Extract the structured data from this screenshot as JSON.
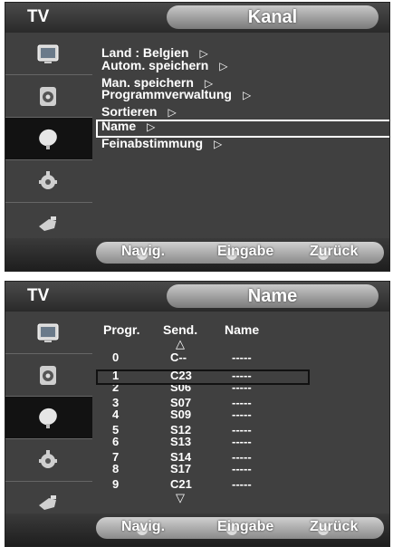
{
  "screen1": {
    "tv_label": "TV",
    "title": "Kanal",
    "menu": [
      {
        "label": "Land  : Belgien",
        "arrow": "▷"
      },
      {
        "label": "Autom. speichern",
        "arrow": "▷"
      },
      {
        "label": "Man. speichern",
        "arrow": "▷"
      },
      {
        "label": "Programmverwaltung",
        "arrow": "▷"
      },
      {
        "label": "Sortieren",
        "arrow": "▷"
      },
      {
        "label": "Name",
        "arrow": "▷"
      },
      {
        "label": "Feinabstimmung",
        "arrow": "▷"
      }
    ],
    "hints": {
      "nav": "Navig.",
      "enter": "Eingabe",
      "back": "Zurück"
    }
  },
  "screen2": {
    "tv_label": "TV",
    "title": "Name",
    "headers": {
      "prog": "Progr.",
      "send": "Send.",
      "name": "Name"
    },
    "up_arrow": "△",
    "down_arrow": "▽",
    "rows": [
      {
        "prog": "0",
        "send": "C--",
        "name": "-----"
      },
      {
        "prog": "1",
        "send": "C23",
        "name": "-----"
      },
      {
        "prog": "2",
        "send": "S06",
        "name": "-----"
      },
      {
        "prog": "3",
        "send": "S07",
        "name": "-----"
      },
      {
        "prog": "4",
        "send": "S09",
        "name": "-----"
      },
      {
        "prog": "5",
        "send": "S12",
        "name": "-----"
      },
      {
        "prog": "6",
        "send": "S13",
        "name": "-----"
      },
      {
        "prog": "7",
        "send": "S14",
        "name": "-----"
      },
      {
        "prog": "8",
        "send": "S17",
        "name": "-----"
      },
      {
        "prog": "9",
        "send": "C21",
        "name": "-----"
      }
    ],
    "hints": {
      "nav": "Navig.",
      "enter": "Eingabe",
      "back": "Zurück"
    }
  },
  "sidebar_icons": [
    "picture-icon",
    "sound-icon",
    "channel-icon",
    "setup-icon",
    "input-icon"
  ]
}
